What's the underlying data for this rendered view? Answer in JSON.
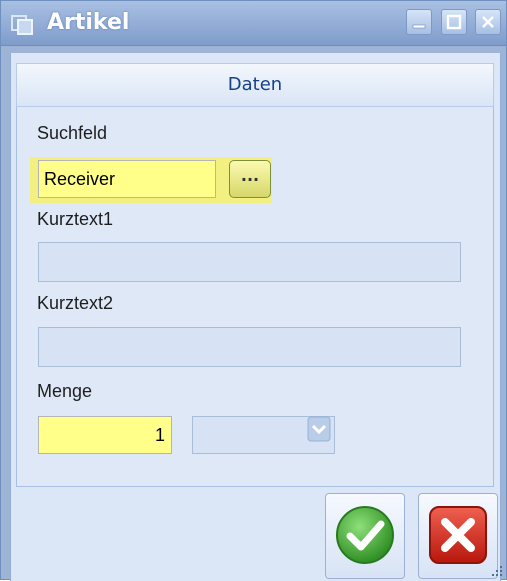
{
  "window": {
    "title": "Artikel",
    "icon": "app-window-icon",
    "controls": [
      "minimize-icon",
      "maximize-icon",
      "close-icon"
    ]
  },
  "section": {
    "header": "Daten"
  },
  "fields": {
    "suchfeld": {
      "label": "Suchfeld",
      "value": "Receiver",
      "lookup_button": "..."
    },
    "kurztext1": {
      "label": "Kurztext1",
      "value": ""
    },
    "kurztext2": {
      "label": "Kurztext2",
      "value": ""
    },
    "menge": {
      "label": "Menge",
      "value": "1",
      "unit_select": ""
    }
  },
  "buttons": {
    "ok": "green-checkmark-icon",
    "cancel": "red-x-icon"
  },
  "colors": {
    "title_gradient_top": "#a9c0e2",
    "title_gradient_bottom": "#7f9ccb",
    "panel_bg": "#dfe8f7",
    "header_text": "#15428b",
    "highlight_yellow": "#ffff8a",
    "ok_green": "#3aa02e",
    "cancel_red": "#d22a1e"
  }
}
